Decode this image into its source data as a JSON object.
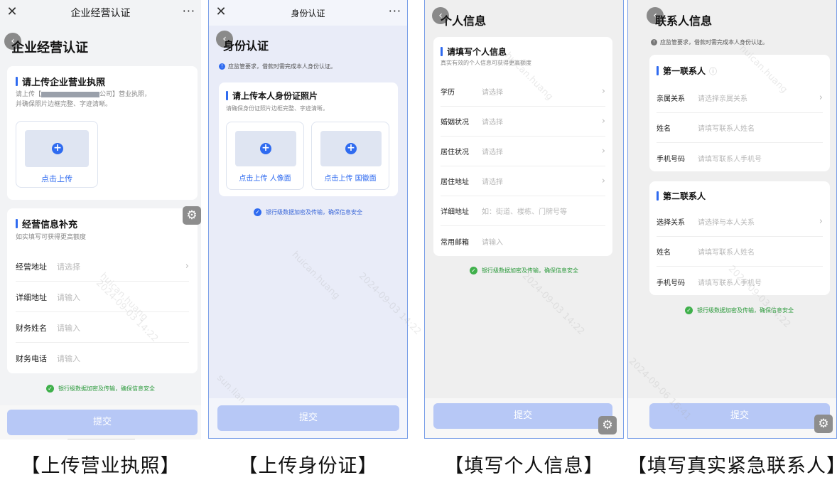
{
  "captions": [
    "【上传营业执照】",
    "【上传身份证】",
    "【填写个人信息】",
    "【填写真实紧急联系人】"
  ],
  "panel1": {
    "nav_title": "企业经营认证",
    "nav_more": "···",
    "page_title": "企业经营认证",
    "license": {
      "title": "请上传企业营业执照",
      "desc_prefix": "请上传【",
      "desc_suffix": "公司】营业执照，",
      "desc_line2": "并确保照片边框完整、字迹清晰。",
      "upload_label": "点击上传"
    },
    "business": {
      "title": "经营信息补充",
      "desc": "如实填写可获得更高额度",
      "rows": [
        {
          "label": "经营地址",
          "value": "请选择",
          "arrow": "›"
        },
        {
          "label": "详细地址",
          "value": "请输入",
          "arrow": ""
        },
        {
          "label": "财务姓名",
          "value": "请输入",
          "arrow": ""
        },
        {
          "label": "财务电话",
          "value": "请输入",
          "arrow": ""
        }
      ]
    },
    "secure_text": "银行级数据加密及传输，确保信息安全",
    "submit": "提交"
  },
  "panel2": {
    "nav_title": "身份认证",
    "nav_more": "···",
    "page_title": "身份认证",
    "notice": "应监管要求，借款时需完成本人身份认证。",
    "id_card": {
      "title": "请上传本人身份证照片",
      "desc": "请确保身份证照片边框完整、字迹清晰。",
      "front_label": "点击上传 人像面",
      "back_label": "点击上传 国徽面"
    },
    "secure_text": "银行级数据加密及传输，确保信息安全",
    "submit": "提交"
  },
  "panel3": {
    "page_title": "个人信息",
    "section_title": "请填写个人信息",
    "section_desc": "真实有效的个人信息可获得更高额度",
    "rows": [
      {
        "label": "学历",
        "value": "请选择",
        "arrow": "›"
      },
      {
        "label": "婚姻状况",
        "value": "请选择",
        "arrow": "›"
      },
      {
        "label": "居住状况",
        "value": "请选择",
        "arrow": "›"
      },
      {
        "label": "居住地址",
        "value": "请选择",
        "arrow": "›"
      },
      {
        "label": "详细地址",
        "value": "如：街道、楼栋、门牌号等",
        "arrow": ""
      },
      {
        "label": "常用邮箱",
        "value": "请输入",
        "arrow": ""
      }
    ],
    "secure_text": "银行级数据加密及传输，确保信息安全",
    "submit": "提交"
  },
  "panel4": {
    "page_title": "联系人信息",
    "notice": "应监管要求，借款时需完成本人身份认证。",
    "first": {
      "title": "第一联系人",
      "rows": [
        {
          "label": "亲属关系",
          "value": "请选择亲属关系",
          "arrow": "›"
        },
        {
          "label": "姓名",
          "value": "请填写联系人姓名",
          "arrow": ""
        },
        {
          "label": "手机号码",
          "value": "请填写联系人手机号",
          "arrow": ""
        }
      ]
    },
    "second": {
      "title": "第二联系人",
      "rows": [
        {
          "label": "选择关系",
          "value": "请选择与本人关系",
          "arrow": "›"
        },
        {
          "label": "姓名",
          "value": "请填写联系人姓名",
          "arrow": ""
        },
        {
          "label": "手机号码",
          "value": "请填写联系人手机号",
          "arrow": ""
        }
      ]
    },
    "secure_text": "银行级数据加密及传输，确保信息安全",
    "submit": "提交"
  },
  "watermark": [
    "huican.huang",
    "2024-09-03 14:22",
    "sun.lian",
    "2024-09-06 16:41"
  ],
  "colors": {
    "accent": "#2f6bf0",
    "secure_green": "#2b9a3b",
    "submit_disabled": "#b7c8f6"
  }
}
